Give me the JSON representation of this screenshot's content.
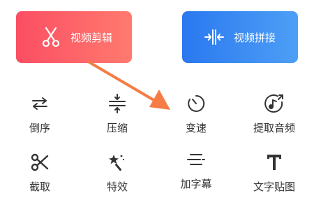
{
  "top_buttons": {
    "edit": {
      "label": "视频剪辑",
      "icon": "scissors-icon"
    },
    "join": {
      "label": "视频拼接",
      "icon": "merge-icon"
    }
  },
  "tools": [
    {
      "label": "倒序",
      "icon": "swap-arrows-icon"
    },
    {
      "label": "压缩",
      "icon": "compress-icon"
    },
    {
      "label": "变速",
      "icon": "speed-dial-icon"
    },
    {
      "label": "提取音频",
      "icon": "music-extract-icon"
    },
    {
      "label": "截取",
      "icon": "scissors-icon"
    },
    {
      "label": "特效",
      "icon": "magic-wand-icon"
    },
    {
      "label": "加字幕",
      "icon": "subtitle-icon"
    },
    {
      "label": "文字贴图",
      "icon": "text-t-icon"
    }
  ],
  "colors": {
    "edit_gradient": [
      "#fb4e63",
      "#ff7a6e"
    ],
    "join_gradient": [
      "#2a78f0",
      "#4d9ff5"
    ],
    "arrow": "#f57c45",
    "icon": "#333333"
  }
}
